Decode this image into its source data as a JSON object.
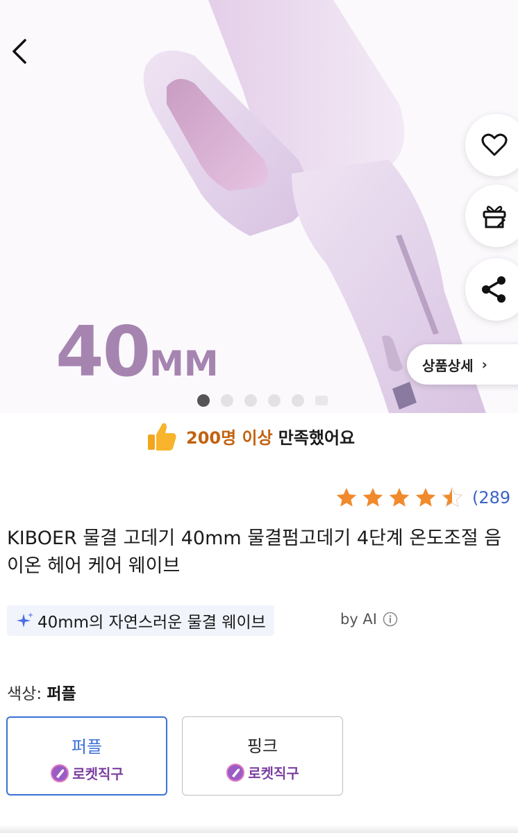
{
  "hero": {
    "size_number": "40",
    "size_unit": "MM",
    "detail_button_label": "상품상세",
    "detail_button_chevron": "›",
    "carousel": {
      "total_dots": 6,
      "active_index": 0
    },
    "icons": [
      "back-arrow-icon",
      "heart-icon",
      "gift-icon",
      "share-icon"
    ]
  },
  "satisfaction": {
    "count_text": "200명 이상",
    "rest_text": "만족했어요"
  },
  "rating": {
    "stars": 4.5,
    "count_text": "(289"
  },
  "product": {
    "title": "KIBOER 물결 고데기 40mm 물결펌고데기 4단계 온도조절 음이온 헤어 케어 웨이브"
  },
  "ai_summary": {
    "text": "40mm의 자연스러운 물결 웨이브",
    "by_label": "by AI"
  },
  "color": {
    "label": "색상: ",
    "selected": "퍼플",
    "options": [
      {
        "name": "퍼플",
        "badge": "로켓직구"
      },
      {
        "name": "핑크",
        "badge": "로켓직구"
      }
    ]
  },
  "colors": {
    "accent_blue": "#3b6fd6",
    "rating_orange": "#f08a2c",
    "satisfaction_orange": "#c26210",
    "rocket_purple": "#7b3fa0",
    "product_purple": "#d9c2e3"
  }
}
